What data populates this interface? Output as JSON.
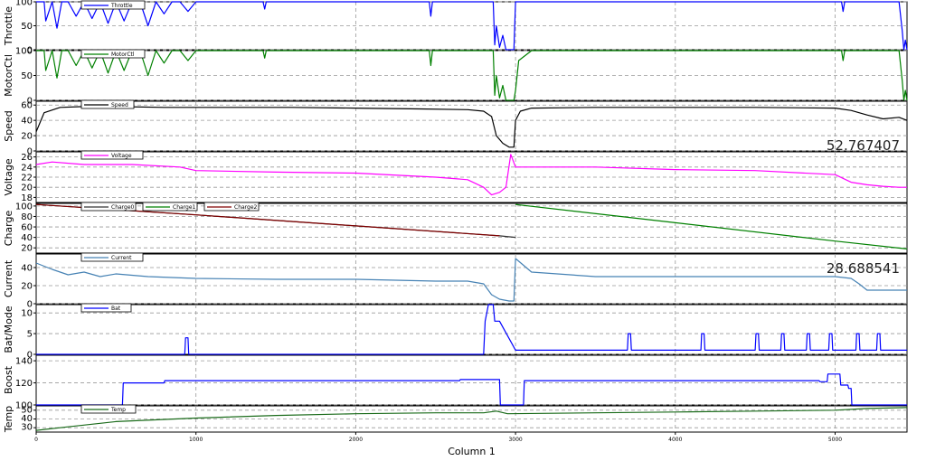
{
  "x_axis": {
    "title": "Column 1",
    "ticks": [
      "0",
      "1000",
      "2000",
      "3000",
      "4000",
      "5000"
    ],
    "range": [
      0,
      5450
    ]
  },
  "chart_data": [
    {
      "type": "line",
      "ylabel": "Throttle",
      "ylim": [
        0,
        100
      ],
      "yticks": [
        "0",
        "50",
        "100"
      ],
      "grid": true,
      "legend": [
        "Throttle"
      ],
      "series": [
        {
          "name": "Throttle",
          "color": "#0000ff",
          "x": [
            0,
            50,
            60,
            100,
            130,
            160,
            200,
            250,
            300,
            350,
            400,
            450,
            500,
            550,
            600,
            650,
            700,
            750,
            800,
            850,
            900,
            950,
            1000,
            1420,
            1430,
            1440,
            2460,
            2470,
            2480,
            2780,
            2860,
            2870,
            2880,
            2900,
            2920,
            2940,
            2960,
            2990,
            3000,
            3020,
            3100,
            5040,
            5050,
            5060,
            5400,
            5420,
            5430,
            5440,
            5450
          ],
          "y": [
            100,
            100,
            60,
            100,
            45,
            100,
            100,
            70,
            100,
            65,
            100,
            55,
            100,
            60,
            100,
            100,
            50,
            100,
            75,
            100,
            100,
            80,
            100,
            100,
            85,
            100,
            100,
            70,
            100,
            100,
            100,
            10,
            50,
            5,
            30,
            0,
            0,
            0,
            100,
            100,
            100,
            100,
            80,
            100,
            100,
            40,
            0,
            20,
            0
          ]
        }
      ]
    },
    {
      "type": "line",
      "ylabel": "MotorCtl",
      "ylim": [
        0,
        100
      ],
      "yticks": [
        "0",
        "50",
        "100"
      ],
      "grid": true,
      "legend": [
        "MotorCtl"
      ],
      "series": [
        {
          "name": "MotorCtl",
          "color": "#008000",
          "x": [
            0,
            50,
            60,
            100,
            130,
            160,
            200,
            250,
            300,
            350,
            400,
            450,
            500,
            550,
            600,
            650,
            700,
            750,
            800,
            850,
            900,
            950,
            1000,
            1420,
            1430,
            1440,
            2460,
            2470,
            2480,
            2780,
            2860,
            2870,
            2880,
            2900,
            2920,
            2940,
            2960,
            2990,
            3000,
            3020,
            3100,
            5040,
            5050,
            5060,
            5400,
            5420,
            5430,
            5440,
            5450
          ],
          "y": [
            100,
            100,
            60,
            100,
            45,
            100,
            100,
            70,
            100,
            65,
            100,
            55,
            100,
            60,
            100,
            100,
            50,
            100,
            75,
            100,
            100,
            80,
            100,
            100,
            85,
            100,
            100,
            70,
            100,
            100,
            100,
            10,
            50,
            5,
            30,
            0,
            0,
            0,
            20,
            80,
            100,
            100,
            80,
            100,
            100,
            40,
            0,
            20,
            0
          ]
        }
      ]
    },
    {
      "type": "line",
      "ylabel": "Speed",
      "ylim": [
        0,
        65
      ],
      "yticks": [
        "0",
        "20",
        "40",
        "60"
      ],
      "grid": true,
      "legend": [
        "Speed"
      ],
      "annotation": "52.767407",
      "series": [
        {
          "name": "Speed",
          "color": "#000000",
          "x": [
            0,
            50,
            150,
            300,
            500,
            800,
            1200,
            1600,
            2000,
            2400,
            2700,
            2800,
            2850,
            2880,
            2920,
            2960,
            2990,
            3000,
            3030,
            3100,
            3500,
            4000,
            4500,
            5000,
            5100,
            5200,
            5300,
            5400,
            5450
          ],
          "y": [
            25,
            50,
            57,
            58,
            58,
            57,
            57,
            57,
            56,
            55,
            54,
            52,
            45,
            20,
            10,
            5,
            5,
            40,
            52,
            56,
            57,
            57,
            57,
            56,
            53,
            47,
            42,
            44,
            40
          ]
        }
      ]
    },
    {
      "type": "line",
      "ylabel": "Voltage",
      "ylim": [
        17,
        27
      ],
      "yticks": [
        "18",
        "20",
        "22",
        "24",
        "26"
      ],
      "grid": true,
      "legend": [
        "Voltage"
      ],
      "series": [
        {
          "name": "Voltage",
          "color": "#ff00ff",
          "x": [
            0,
            100,
            300,
            600,
            900,
            1000,
            1500,
            2000,
            2500,
            2700,
            2800,
            2850,
            2900,
            2940,
            2970,
            3000,
            3100,
            3500,
            4000,
            4500,
            5000,
            5100,
            5200,
            5300,
            5400,
            5450
          ],
          "y": [
            24.5,
            25,
            24.5,
            24.5,
            24,
            23.3,
            23,
            22.8,
            22,
            21.5,
            20,
            18.5,
            19,
            20,
            26.5,
            24,
            24,
            24,
            23.5,
            23.3,
            22.5,
            21,
            20.5,
            20.2,
            20,
            20
          ]
        }
      ]
    },
    {
      "type": "line",
      "ylabel": "Charge",
      "ylim": [
        10,
        105
      ],
      "yticks": [
        "20",
        "40",
        "60",
        "80",
        "100"
      ],
      "grid": true,
      "legend": [
        "Charge0",
        "Charge1",
        "Charge2"
      ],
      "series": [
        {
          "name": "Charge0",
          "color": "#333333",
          "x": [
            0,
            1000,
            2000,
            2900,
            3000
          ],
          "y": [
            103,
            83,
            62,
            43,
            40
          ]
        },
        {
          "name": "Charge1",
          "color": "#008000",
          "x": [
            3000,
            4000,
            5000,
            5450
          ],
          "y": [
            103,
            68,
            33,
            18
          ]
        },
        {
          "name": "Charge2",
          "color": "#800000",
          "x": [
            0,
            1000,
            2000,
            2900
          ],
          "y": [
            103,
            83,
            62,
            43
          ]
        }
      ]
    },
    {
      "type": "line",
      "ylabel": "Current",
      "ylim": [
        0,
        55
      ],
      "yticks": [
        "0",
        "20",
        "40"
      ],
      "grid": true,
      "legend": [
        "Current"
      ],
      "annotation": "28.688541",
      "series": [
        {
          "name": "Current",
          "color": "#4682b4",
          "x": [
            0,
            100,
            200,
            300,
            400,
            500,
            700,
            1000,
            1500,
            2000,
            2500,
            2700,
            2800,
            2850,
            2900,
            2960,
            2990,
            3000,
            3100,
            3500,
            4000,
            4500,
            5000,
            5100,
            5150,
            5200,
            5300,
            5450
          ],
          "y": [
            45,
            38,
            32,
            35,
            30,
            33,
            30,
            28,
            27,
            27,
            25,
            25,
            22,
            10,
            5,
            3,
            3,
            50,
            35,
            30,
            30,
            30,
            30,
            28,
            22,
            15,
            15,
            15
          ]
        }
      ]
    },
    {
      "type": "line",
      "ylabel": "Bat/Mode",
      "ylim": [
        0,
        12
      ],
      "yticks": [
        "0",
        "5",
        "10"
      ],
      "grid": true,
      "legend": [
        "Bat"
      ],
      "series": [
        {
          "name": "Bat",
          "color": "#0000ff",
          "x": [
            0,
            930,
            935,
            950,
            955,
            2800,
            2810,
            2830,
            2840,
            2860,
            2870,
            2900,
            3000,
            3700,
            3705,
            3720,
            3725,
            4160,
            4165,
            4180,
            4185,
            4500,
            4505,
            4520,
            4525,
            4660,
            4665,
            4680,
            4685,
            4820,
            4825,
            4840,
            4845,
            4960,
            4965,
            4980,
            4985,
            5130,
            5135,
            5150,
            5155,
            5260,
            5265,
            5280,
            5285,
            5450
          ],
          "y": [
            0,
            0,
            4,
            4,
            0,
            0,
            8,
            12,
            12,
            12,
            8,
            8,
            1,
            1,
            5,
            5,
            1,
            1,
            5,
            5,
            1,
            1,
            5,
            5,
            1,
            1,
            5,
            5,
            1,
            1,
            5,
            5,
            1,
            1,
            5,
            5,
            1,
            1,
            5,
            5,
            1,
            1,
            5,
            5,
            1,
            1
          ]
        }
      ]
    },
    {
      "type": "line",
      "ylabel": "Boost",
      "ylim": [
        100,
        145
      ],
      "yticks": [
        "100",
        "120",
        "140"
      ],
      "grid": true,
      "legend": [],
      "series": [
        {
          "name": "",
          "color": "#0000ff",
          "x": [
            0,
            540,
            545,
            800,
            805,
            2650,
            2655,
            2900,
            2905,
            2920,
            3050,
            3055,
            4900,
            4905,
            4950,
            4955,
            5030,
            5035,
            5080,
            5085,
            5100,
            5105,
            5450
          ],
          "y": [
            100,
            100,
            120,
            120,
            122,
            122,
            123,
            123,
            100,
            100,
            100,
            122,
            122,
            121,
            121,
            128,
            128,
            118,
            118,
            115,
            115,
            100,
            100
          ]
        }
      ]
    },
    {
      "type": "line",
      "ylabel": "Temp",
      "ylim": [
        25,
        55
      ],
      "yticks": [
        "30",
        "40",
        "50"
      ],
      "grid": true,
      "legend": [
        "Temp"
      ],
      "series": [
        {
          "name": "Temp",
          "color": "#1a6b1a",
          "x": [
            0,
            200,
            500,
            1000,
            1500,
            2000,
            2500,
            2800,
            2880,
            2950,
            3500,
            4000,
            4500,
            5000,
            5200,
            5450
          ],
          "y": [
            27,
            31,
            37,
            41,
            44,
            46,
            47,
            47,
            49,
            46,
            47,
            48,
            49,
            50,
            52,
            53
          ]
        }
      ]
    }
  ]
}
